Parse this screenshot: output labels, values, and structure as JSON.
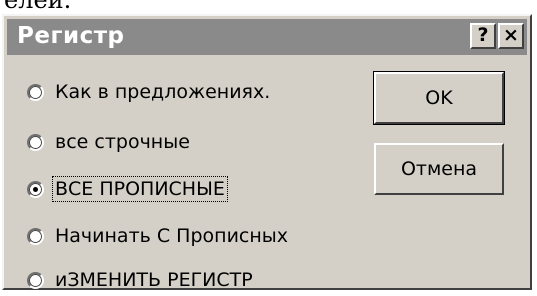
{
  "page_fragment": "елей.",
  "dialog": {
    "title": "Регистр",
    "help_label": "?",
    "close_label": "×"
  },
  "options": [
    {
      "label": "Как в предложениях.",
      "checked": false
    },
    {
      "label": "все строчные",
      "checked": false
    },
    {
      "label": "ВСЕ ПРОПИСНЫЕ",
      "checked": true
    },
    {
      "label": "Начинать С Прописных",
      "checked": false
    },
    {
      "label": "иЗМЕНИТЬ РЕГИСТР",
      "checked": false
    }
  ],
  "buttons": {
    "ok_label": "OK",
    "cancel_label": "Отмена"
  }
}
